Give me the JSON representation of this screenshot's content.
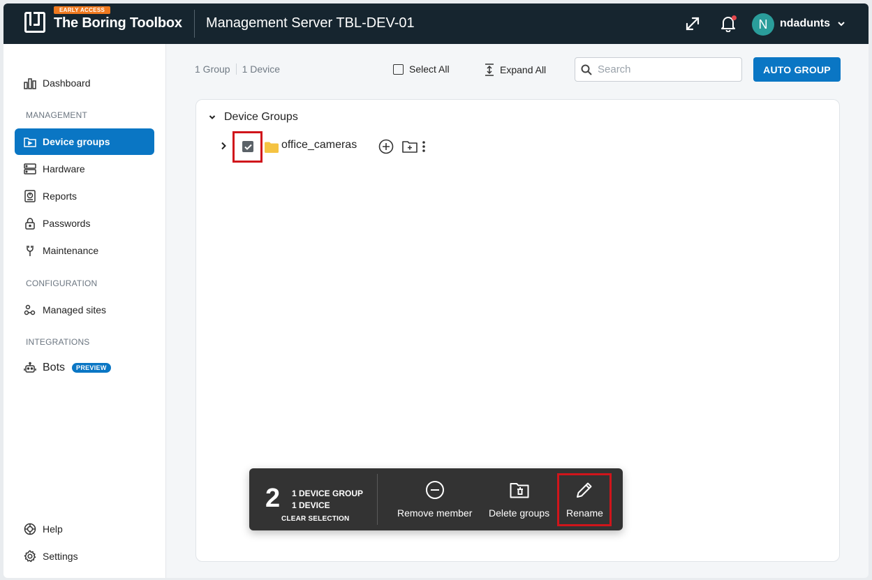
{
  "header": {
    "badge": "EARLY ACCESS",
    "brand": "The Boring Toolbox",
    "server_title": "Management Server TBL-DEV-01",
    "avatar_initial": "N",
    "username": "ndadunts"
  },
  "sidebar": {
    "dashboard": "Dashboard",
    "management_label": "MANAGEMENT",
    "device_groups": "Device groups",
    "hardware": "Hardware",
    "reports": "Reports",
    "passwords": "Passwords",
    "maintenance": "Maintenance",
    "configuration_label": "CONFIGURATION",
    "managed_sites": "Managed sites",
    "integrations_label": "INTEGRATIONS",
    "bots": "Bots",
    "bots_badge": "PREVIEW",
    "help": "Help",
    "settings": "Settings"
  },
  "toolbar": {
    "group_count": "1 Group",
    "device_count": "1 Device",
    "select_all": "Select All",
    "expand_all": "Expand All",
    "search_placeholder": "Search",
    "auto_group": "AUTO GROUP"
  },
  "tree": {
    "root_label": "Device Groups",
    "group_name": "office_cameras",
    "group_checked": true
  },
  "selection_bar": {
    "count": "2",
    "line1": "1 DEVICE GROUP",
    "line2": "1 DEVICE",
    "clear": "CLEAR SELECTION",
    "remove_member": "Remove member",
    "delete_groups": "Delete groups",
    "rename": "Rename"
  },
  "colors": {
    "topbar": "#16252f",
    "accent": "#0a76c4",
    "badge_orange": "#f0791f",
    "highlight_red": "#d0151b"
  }
}
